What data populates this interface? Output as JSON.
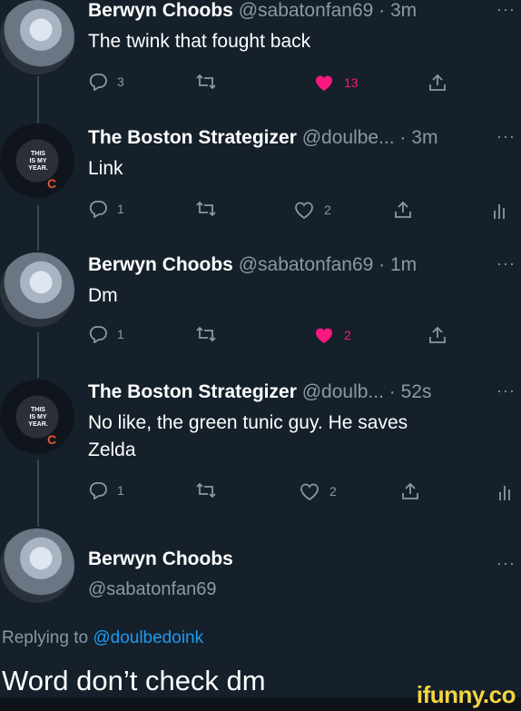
{
  "tweets": [
    {
      "name": "Berwyn Choobs",
      "handle_time": "@sabatonfan69 · 3m",
      "text": "The twink that fought back",
      "reply_count": "3",
      "retweet_count": "",
      "like_count": "13",
      "liked": true
    },
    {
      "name": "The Boston Strategizer",
      "handle_time": "@doulbe... · 3m",
      "text": "Link",
      "reply_count": "1",
      "retweet_count": "",
      "like_count": "2",
      "liked": false
    },
    {
      "name": "Berwyn Choobs",
      "handle_time": "@sabatonfan69 · 1m",
      "text": "Dm",
      "reply_count": "1",
      "retweet_count": "",
      "like_count": "2",
      "liked": true
    },
    {
      "name": "The Boston Strategizer",
      "handle_time": "@doulb... · 52s",
      "text_line1": "No like, the green tunic guy. He saves",
      "text_line2": "Zelda",
      "reply_count": "1",
      "retweet_count": "",
      "like_count": "2",
      "liked": false
    }
  ],
  "avatar_text": "THIS IS MY YEAR.",
  "avatar_logo": "C",
  "main_tweet": {
    "name": "Berwyn Choobs",
    "handle": "@sabatonfan69",
    "replying_prefix": "Replying to",
    "replying_mention": "@doulbedoink",
    "text": "Word don’t check dm"
  },
  "more_label": "···",
  "watermark": "ifunny.co",
  "colors": {
    "background": "#15202b",
    "like_pink": "#f91880",
    "mention_blue": "#1d9bf0",
    "muted": "#8b98a5"
  }
}
